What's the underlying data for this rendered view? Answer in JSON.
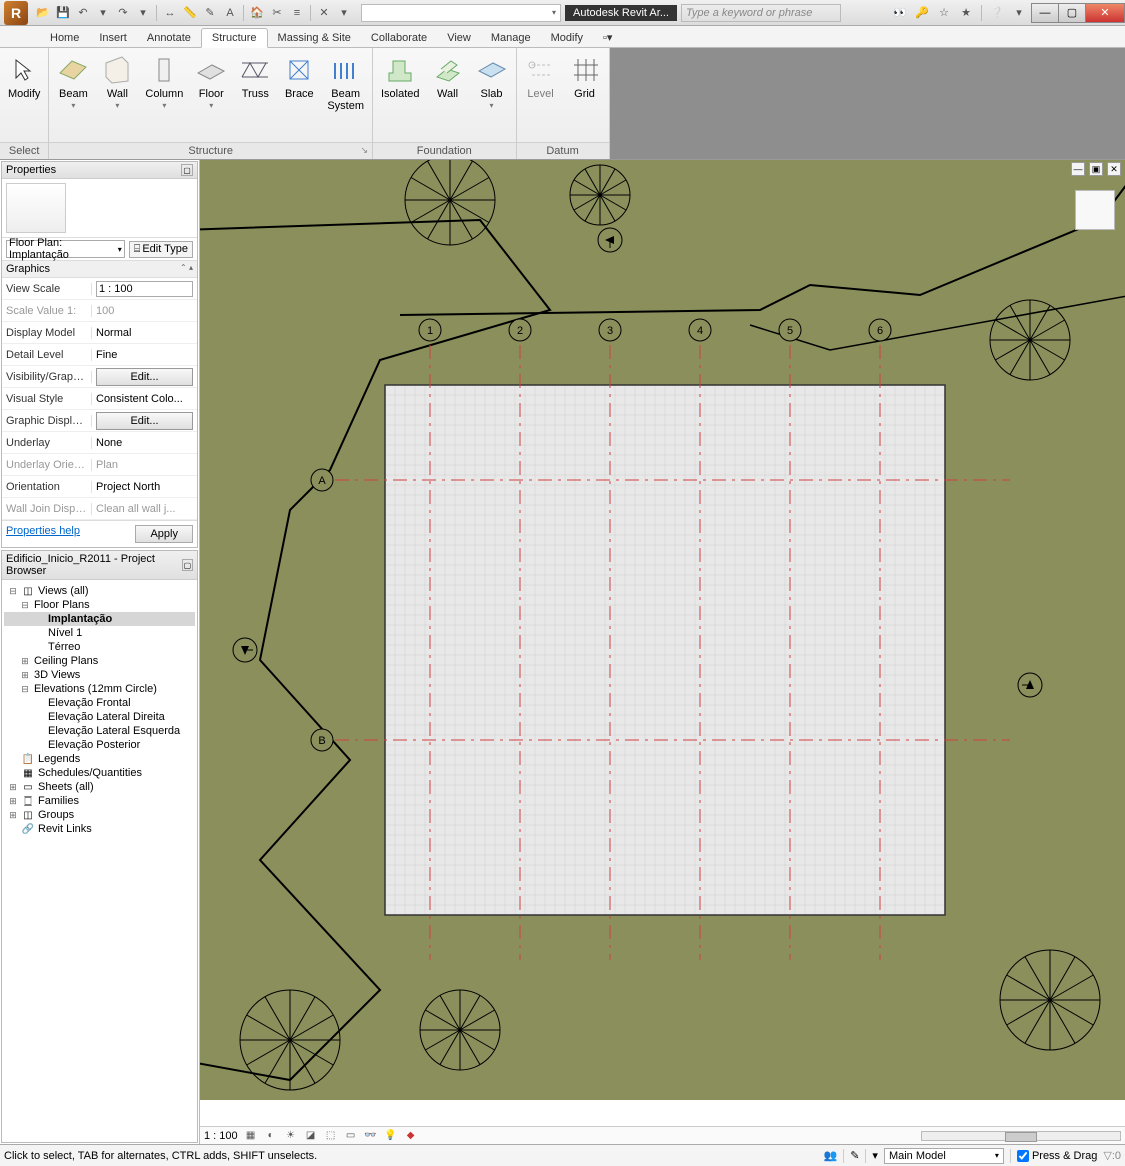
{
  "titlebar": {
    "app_title": "Autodesk Revit Ar...",
    "search_placeholder": "Type a keyword or phrase"
  },
  "menu": {
    "tabs": [
      "Home",
      "Insert",
      "Annotate",
      "Structure",
      "Massing & Site",
      "Collaborate",
      "View",
      "Manage",
      "Modify"
    ],
    "active": "Structure"
  },
  "ribbon": {
    "groups": [
      {
        "title": "Select",
        "items": [
          {
            "label": "Modify",
            "drop": false
          }
        ]
      },
      {
        "title": "Structure",
        "arrow": true,
        "items": [
          {
            "label": "Beam",
            "drop": true
          },
          {
            "label": "Wall",
            "drop": true
          },
          {
            "label": "Column",
            "drop": true
          },
          {
            "label": "Floor",
            "drop": true
          },
          {
            "label": "Truss",
            "drop": false
          },
          {
            "label": "Brace",
            "drop": false
          },
          {
            "label": "Beam\nSystem",
            "drop": false
          }
        ]
      },
      {
        "title": "Foundation",
        "items": [
          {
            "label": "Isolated",
            "drop": false
          },
          {
            "label": "Wall",
            "drop": false
          },
          {
            "label": "Slab",
            "drop": true
          }
        ]
      },
      {
        "title": "Datum",
        "items": [
          {
            "label": "Level",
            "drop": false,
            "disabled": true
          },
          {
            "label": "Grid",
            "drop": false
          }
        ]
      }
    ]
  },
  "properties": {
    "title": "Properties",
    "type_selector": "Floor Plan: Implantação",
    "edit_type": "Edit Type",
    "section": "Graphics",
    "rows": [
      {
        "name": "View Scale",
        "value": "1 : 100",
        "editable": true
      },
      {
        "name": "Scale Value   1:",
        "value": "100",
        "muted": true
      },
      {
        "name": "Display Model",
        "value": "Normal"
      },
      {
        "name": "Detail Level",
        "value": "Fine"
      },
      {
        "name": "Visibility/Graphi...",
        "value": "Edit...",
        "button": true
      },
      {
        "name": "Visual Style",
        "value": "Consistent Colo..."
      },
      {
        "name": "Graphic Display ...",
        "value": "Edit...",
        "button": true
      },
      {
        "name": "Underlay",
        "value": "None"
      },
      {
        "name": "Underlay Orient...",
        "value": "Plan",
        "muted": true
      },
      {
        "name": "Orientation",
        "value": "Project North"
      },
      {
        "name": "Wall Join Display",
        "value": "Clean all wall j...",
        "muted": true
      }
    ],
    "help": "Properties help",
    "apply": "Apply"
  },
  "browser": {
    "title": "Edificio_Inicio_R2011 - Project Browser",
    "tree": [
      {
        "level": 0,
        "toggle": "-",
        "icon": "◫",
        "label": "Views (all)"
      },
      {
        "level": 1,
        "toggle": "-",
        "label": "Floor Plans"
      },
      {
        "level": 2,
        "label": "Implantação",
        "bold": true,
        "sel": true
      },
      {
        "level": 2,
        "label": "Nível 1"
      },
      {
        "level": 2,
        "label": "Térreo"
      },
      {
        "level": 1,
        "toggle": "+",
        "label": "Ceiling Plans"
      },
      {
        "level": 1,
        "toggle": "+",
        "label": "3D Views"
      },
      {
        "level": 1,
        "toggle": "-",
        "label": "Elevations (12mm Circle)"
      },
      {
        "level": 2,
        "label": "Elevação Frontal"
      },
      {
        "level": 2,
        "label": "Elevação Lateral Direita"
      },
      {
        "level": 2,
        "label": "Elevação Lateral Esquerda"
      },
      {
        "level": 2,
        "label": "Elevação Posterior"
      },
      {
        "level": 0,
        "icon": "📋",
        "label": "Legends"
      },
      {
        "level": 0,
        "icon": "▦",
        "label": "Schedules/Quantities"
      },
      {
        "level": 0,
        "toggle": "+",
        "icon": "▭",
        "label": "Sheets (all)"
      },
      {
        "level": 0,
        "toggle": "+",
        "icon": "🀆",
        "label": "Families"
      },
      {
        "level": 0,
        "toggle": "+",
        "icon": "◫",
        "label": "Groups"
      },
      {
        "level": 0,
        "icon": "🔗",
        "label": "Revit Links"
      }
    ]
  },
  "viewbar": {
    "scale": "1 : 100"
  },
  "status": {
    "hint": "Click to select, TAB for alternates, CTRL adds, SHIFT unselects.",
    "workset": "Main Model",
    "press_drag": "Press & Drag"
  },
  "grids": {
    "cols": [
      "1",
      "2",
      "3",
      "4",
      "5",
      "6"
    ],
    "rows": [
      "A",
      "B"
    ]
  }
}
